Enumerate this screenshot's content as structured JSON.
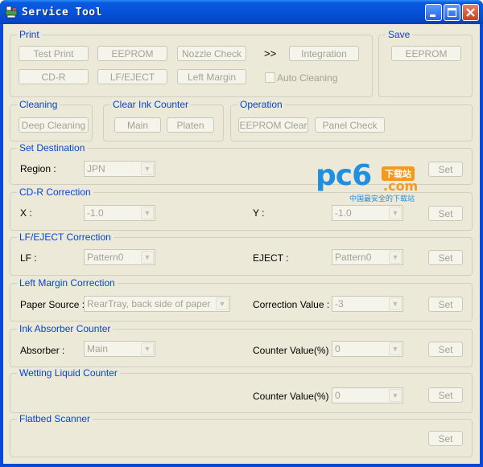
{
  "window": {
    "title": "Service Tool"
  },
  "print": {
    "label": "Print",
    "test_print": "Test Print",
    "eeprom": "EEPROM",
    "nozzle_check": "Nozzle Check",
    "chevron": ">>",
    "integration": "Integration",
    "cd_r": "CD-R",
    "lf_eject": "LF/EJECT",
    "left_margin": "Left Margin",
    "auto_cleaning": "Auto Cleaning"
  },
  "save": {
    "label": "Save",
    "eeprom": "EEPROM"
  },
  "cleaning": {
    "label": "Cleaning",
    "deep_cleaning": "Deep Cleaning"
  },
  "clear_ink": {
    "label": "Clear Ink Counter",
    "main": "Main",
    "platen": "Platen"
  },
  "operation": {
    "label": "Operation",
    "eeprom_clear": "EEPROM Clear",
    "panel_check": "Panel Check"
  },
  "set_destination": {
    "label": "Set Destination",
    "region_label": "Region :",
    "region_value": "JPN",
    "set": "Set"
  },
  "cdr_correction": {
    "label": "CD-R Correction",
    "x_label": "X :",
    "x_value": "-1.0",
    "y_label": "Y :",
    "y_value": "-1.0",
    "set": "Set"
  },
  "lf_eject_correction": {
    "label": "LF/EJECT Correction",
    "lf_label": "LF :",
    "lf_value": "Pattern0",
    "eject_label": "EJECT :",
    "eject_value": "Pattern0",
    "set": "Set"
  },
  "left_margin_correction": {
    "label": "Left Margin Correction",
    "paper_source_label": "Paper Source :",
    "paper_source_value": "RearTray, back side of paper",
    "correction_label": "Correction Value :",
    "correction_value": "-3",
    "set": "Set"
  },
  "ink_absorber": {
    "label": "Ink Absorber Counter",
    "absorber_label": "Absorber :",
    "absorber_value": "Main",
    "counter_label": "Counter Value(%) :",
    "counter_value": "0",
    "set": "Set"
  },
  "wetting_liquid": {
    "label": "Wetting Liquid Counter",
    "counter_label": "Counter Value(%) :",
    "counter_value": "0",
    "set": "Set"
  },
  "flatbed": {
    "label": "Flatbed Scanner",
    "set": "Set"
  },
  "watermark": {
    "logo": "pc6",
    "badge": "下载站",
    "domain": ".com",
    "tagline": "中国最安全的下载站"
  },
  "colors": {
    "titlebar": "#0653d8",
    "window_bg": "#ece9d8",
    "group_label": "#0046d5",
    "disabled_text": "#a4a293",
    "watermark_blue": "#1f8fe0",
    "watermark_orange": "#f39a1e"
  }
}
